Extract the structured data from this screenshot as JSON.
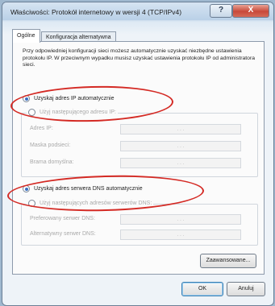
{
  "window": {
    "title": "Właściwości: Protokół internetowy w wersji 4 (TCP/IPv4)",
    "help_glyph": "?",
    "close_glyph": "X"
  },
  "tabs": [
    {
      "label": "Ogólne",
      "active": true
    },
    {
      "label": "Konfiguracja alternatywna",
      "active": false
    }
  ],
  "description": "Przy odpowiedniej konfiguracji sieci możesz automatycznie uzyskać niezbędne ustawienia protokołu IP. W przeciwnym wypadku musisz uzyskać ustawienia protokołu IP od administratora sieci.",
  "ip": {
    "auto_label": "Uzyskaj adres IP automatycznie",
    "auto_selected": true,
    "manual_label": "Użyj następującego adresu IP:",
    "fields": [
      {
        "label": "Adres IP:",
        "value": ". . ."
      },
      {
        "label": "Maska podsieci:",
        "value": ". . ."
      },
      {
        "label": "Brama domyślna:",
        "value": ". . ."
      }
    ]
  },
  "dns": {
    "auto_label": "Uzyskaj adres serwera DNS automatycznie",
    "auto_selected": true,
    "manual_label": "Użyj następujących adresów serwerów DNS:",
    "fields": [
      {
        "label": "Preferowany serwer DNS:",
        "value": ". . ."
      },
      {
        "label": "Alternatywny serwer DNS:",
        "value": ". . ."
      }
    ]
  },
  "buttons": {
    "advanced": "Zaawansowane...",
    "ok": "OK",
    "cancel": "Anuluj"
  },
  "annotation_color": "#d42a24"
}
